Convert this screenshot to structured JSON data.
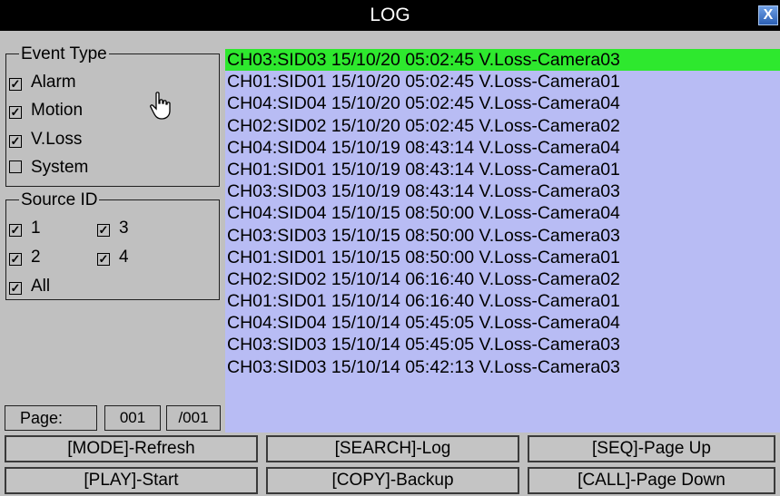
{
  "title": "LOG",
  "close_label": "X",
  "event_type": {
    "legend": "Event Type",
    "items": [
      {
        "label": "Alarm",
        "checked": true
      },
      {
        "label": "Motion",
        "checked": true
      },
      {
        "label": "V.Loss",
        "checked": true
      },
      {
        "label": "System",
        "checked": false
      }
    ]
  },
  "source_id": {
    "legend": "Source ID",
    "items": [
      {
        "label": "1",
        "checked": true
      },
      {
        "label": "3",
        "checked": true
      },
      {
        "label": "2",
        "checked": true
      },
      {
        "label": "4",
        "checked": true
      },
      {
        "label": "All",
        "checked": true
      }
    ]
  },
  "page": {
    "label": "Page:",
    "current": "001",
    "total": "/001"
  },
  "log_entries": [
    "CH03:SID03 15/10/20 05:02:45 V.Loss-Camera03",
    "CH01:SID01 15/10/20 05:02:45 V.Loss-Camera01",
    "CH04:SID04 15/10/20 05:02:45 V.Loss-Camera04",
    "CH02:SID02 15/10/20 05:02:45 V.Loss-Camera02",
    "CH04:SID04 15/10/19 08:43:14 V.Loss-Camera04",
    "CH01:SID01 15/10/19 08:43:14 V.Loss-Camera01",
    "CH03:SID03 15/10/19 08:43:14 V.Loss-Camera03",
    "CH04:SID04 15/10/15 08:50:00 V.Loss-Camera04",
    "CH03:SID03 15/10/15 08:50:00 V.Loss-Camera03",
    "CH01:SID01 15/10/15 08:50:00 V.Loss-Camera01",
    "CH02:SID02 15/10/14 06:16:40 V.Loss-Camera02",
    "CH01:SID01 15/10/14 06:16:40 V.Loss-Camera01",
    "CH04:SID04 15/10/14 05:45:05 V.Loss-Camera04",
    "CH03:SID03 15/10/14 05:45:05 V.Loss-Camera03",
    "CH03:SID03 15/10/14 05:42:13 V.Loss-Camera03"
  ],
  "selected_index": 0,
  "buttons": {
    "refresh": "[MODE]-Refresh",
    "log": "[SEARCH]-Log",
    "page_up": "[SEQ]-Page Up",
    "start": "[PLAY]-Start",
    "backup": "[COPY]-Backup",
    "page_down": "[CALL]-Page Down"
  },
  "colors": {
    "selected_row": "#2ee82e",
    "list_bg": "#b8bcf4",
    "panel_bg": "#c0c0c0",
    "titlebar_bg": "#000000"
  }
}
